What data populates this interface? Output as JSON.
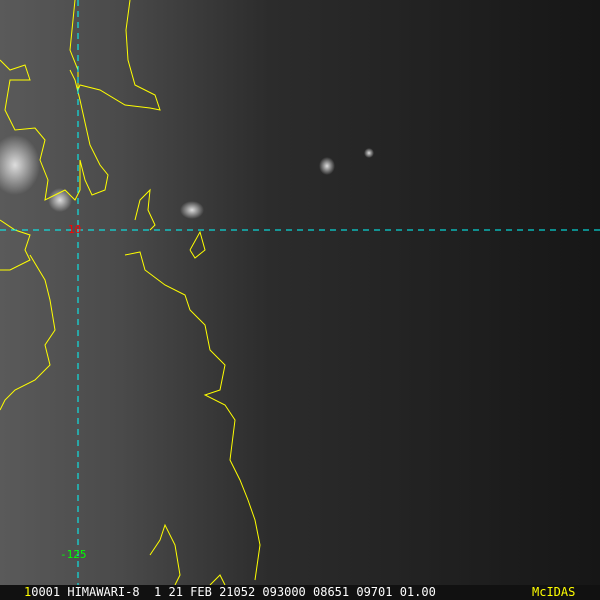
{
  "map": {
    "latitude_label": "10",
    "longitude_label": "-125",
    "colors": {
      "coastline": "#ffff00",
      "gridline": "#00ffff",
      "lat_label": "#ff0000",
      "lon_label": "#00ff00"
    }
  },
  "status_bar": {
    "frame": "1",
    "text": "0001 HIMAWARI-8  1 21 FEB 21052 093000 08651 09701 01.00",
    "logo": "McIDAS"
  }
}
